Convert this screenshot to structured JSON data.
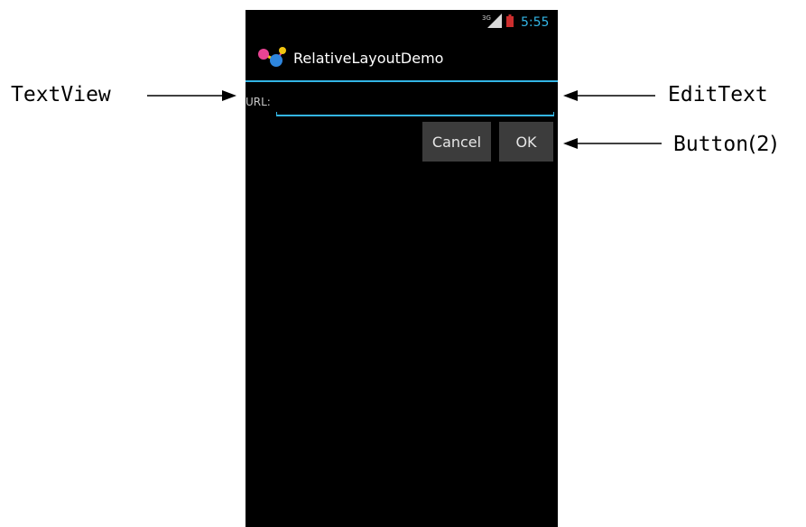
{
  "status_bar": {
    "network": "3G",
    "time": "5:55"
  },
  "app": {
    "title": "RelativeLayoutDemo",
    "icon": "relative-layout-app-icon"
  },
  "form": {
    "url_label": "URL:",
    "url_value": "",
    "cancel_label": "Cancel",
    "ok_label": "OK"
  },
  "annotations": {
    "textview": "TextView",
    "edittext": "EditText",
    "button_word": "Button",
    "button_count": "(2)"
  },
  "colors": {
    "accent": "#33b5e5",
    "screen_background": "#000000",
    "button_background": "#3c3c3c",
    "battery": "#cc2e2e"
  }
}
